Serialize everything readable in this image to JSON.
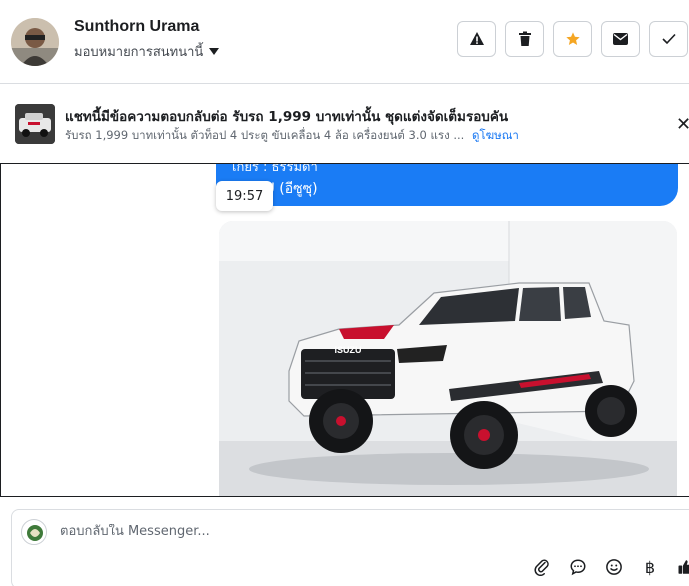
{
  "header": {
    "user_name": "Sunthorn Urama",
    "assign_label": "มอบหมายการสนทนานี้"
  },
  "actions": [
    {
      "name": "alert-button",
      "icon": "warning-icon"
    },
    {
      "name": "delete-button",
      "icon": "trash-icon"
    },
    {
      "name": "star-button",
      "icon": "star-icon"
    },
    {
      "name": "mail-button",
      "icon": "envelope-icon"
    },
    {
      "name": "done-button",
      "icon": "check-icon"
    }
  ],
  "ad": {
    "title": "แชทนี้มีข้อความตอบกลับต่อ รับรถ 1,999 บาทเท่านั้น ชุดแต่งจัดเต็มรอบคัน",
    "description": "รับรถ 1,999 บาทเท่านั้น ตัวท็อป 4 ประตู ขับเคลื่อน 4 ล้อ เครื่องยนต์ 3.0 แรง ...",
    "link": "ดูโฆษณา",
    "close_icon": "close-icon"
  },
  "conversation": {
    "message_line1": "เกียร์ : ธรรมดา",
    "message_line2": "ISUZU (อีซูซุ)",
    "timestamp": "19:57",
    "photo_badge": "ISUZU"
  },
  "composer": {
    "placeholder": "ตอบกลับใน Messenger..."
  },
  "colors": {
    "accent": "#1a7cf5",
    "star": "#f5a623",
    "link": "#1877f2"
  }
}
